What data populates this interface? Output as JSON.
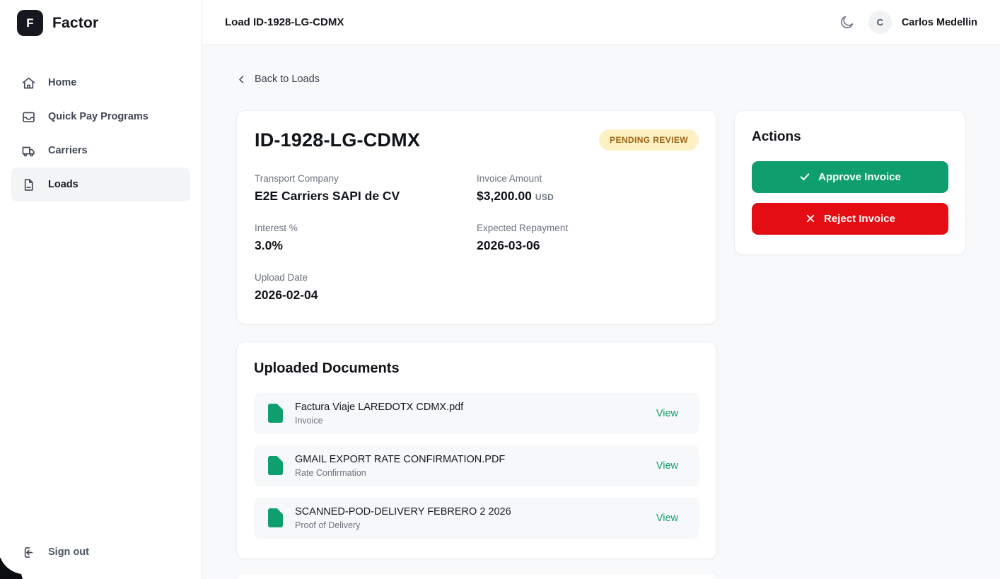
{
  "brand": {
    "logo_letter": "F",
    "name": "Factor"
  },
  "sidebar": {
    "items": [
      {
        "label": "Home"
      },
      {
        "label": "Quick Pay Programs"
      },
      {
        "label": "Carriers"
      },
      {
        "label": "Loads"
      }
    ],
    "sign_out": "Sign out"
  },
  "header": {
    "title": "Load ID-1928-LG-CDMX",
    "user_initial": "C",
    "user_name": "Carlos Medellin"
  },
  "main": {
    "back_link": "Back to Loads",
    "load_card": {
      "title": "ID-1928-LG-CDMX",
      "status": "PENDING REVIEW",
      "fields": [
        {
          "label": "Transport Company",
          "value": "E2E Carriers SAPI de CV",
          "suffix": ""
        },
        {
          "label": "Invoice Amount",
          "value": "$3,200.00",
          "suffix": "USD"
        },
        {
          "label": "Interest %",
          "value": "3.0%",
          "suffix": ""
        },
        {
          "label": "Expected Repayment",
          "value": "2026-03-06",
          "suffix": ""
        },
        {
          "label": "Upload Date",
          "value": "2026-02-04",
          "suffix": ""
        }
      ]
    },
    "actions_card": {
      "title": "Actions",
      "approve": "Approve Invoice",
      "reject": "Reject Invoice"
    },
    "documents_card": {
      "title": "Uploaded Documents",
      "documents": [
        {
          "name": "Factura Viaje LAREDOTX CDMX.pdf",
          "type": "Invoice",
          "action": "View"
        },
        {
          "name": "GMAIL EXPORT RATE CONFIRMATION.PDF",
          "type": "Rate Confirmation",
          "action": "View"
        },
        {
          "name": "SCANNED-POD-DELIVERY FEBRERO 2 2026",
          "type": "Proof of Delivery",
          "action": "View"
        }
      ]
    }
  },
  "colors": {
    "accent_green": "#0f9e6e",
    "danger_red": "#e30d13",
    "badge_bg": "#fdf0c3",
    "badge_text": "#9a6514"
  }
}
